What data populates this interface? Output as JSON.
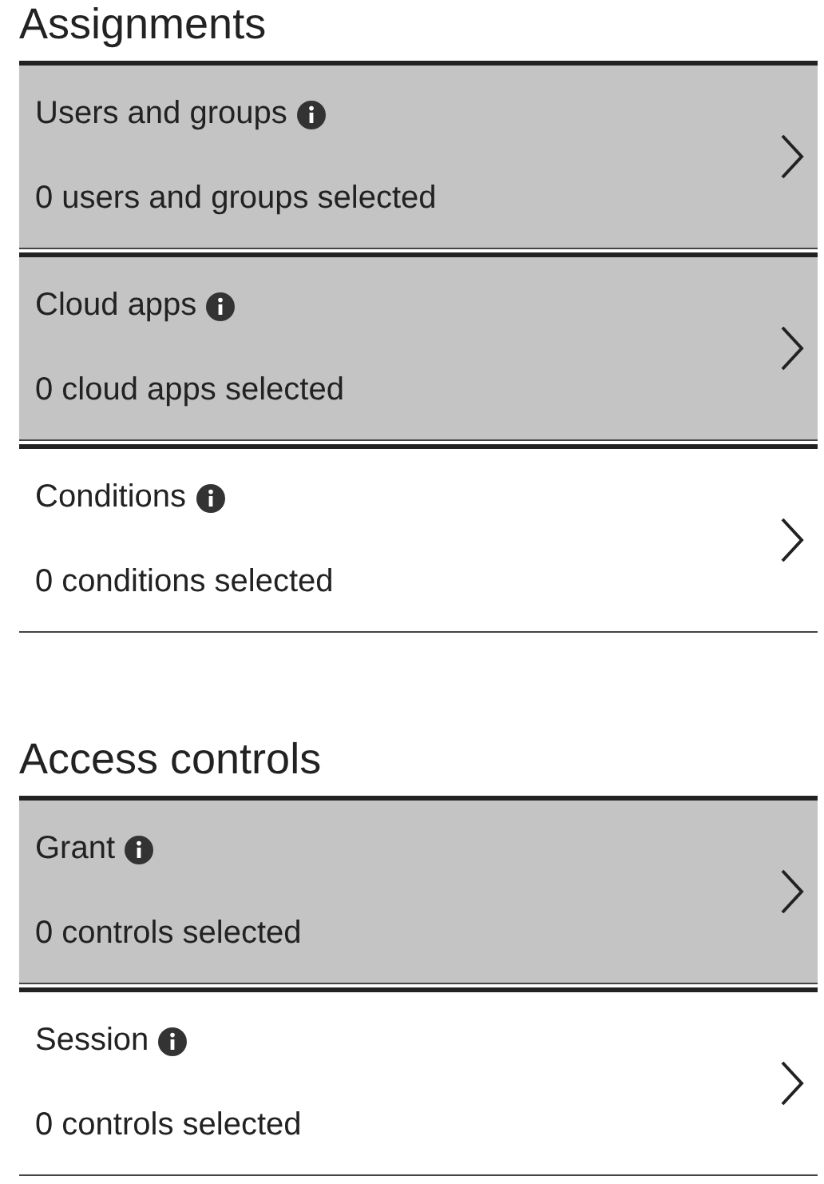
{
  "sections": [
    {
      "title": "Assignments",
      "items": [
        {
          "label": "Users and groups",
          "summary": "0 users and groups selected",
          "selected": true
        },
        {
          "label": "Cloud apps",
          "summary": "0 cloud apps selected",
          "selected": true
        },
        {
          "label": "Conditions",
          "summary": "0 conditions selected",
          "selected": false
        }
      ]
    },
    {
      "title": "Access controls",
      "items": [
        {
          "label": "Grant",
          "summary": "0 controls selected",
          "selected": true
        },
        {
          "label": "Session",
          "summary": "0 controls selected",
          "selected": false
        }
      ]
    }
  ]
}
